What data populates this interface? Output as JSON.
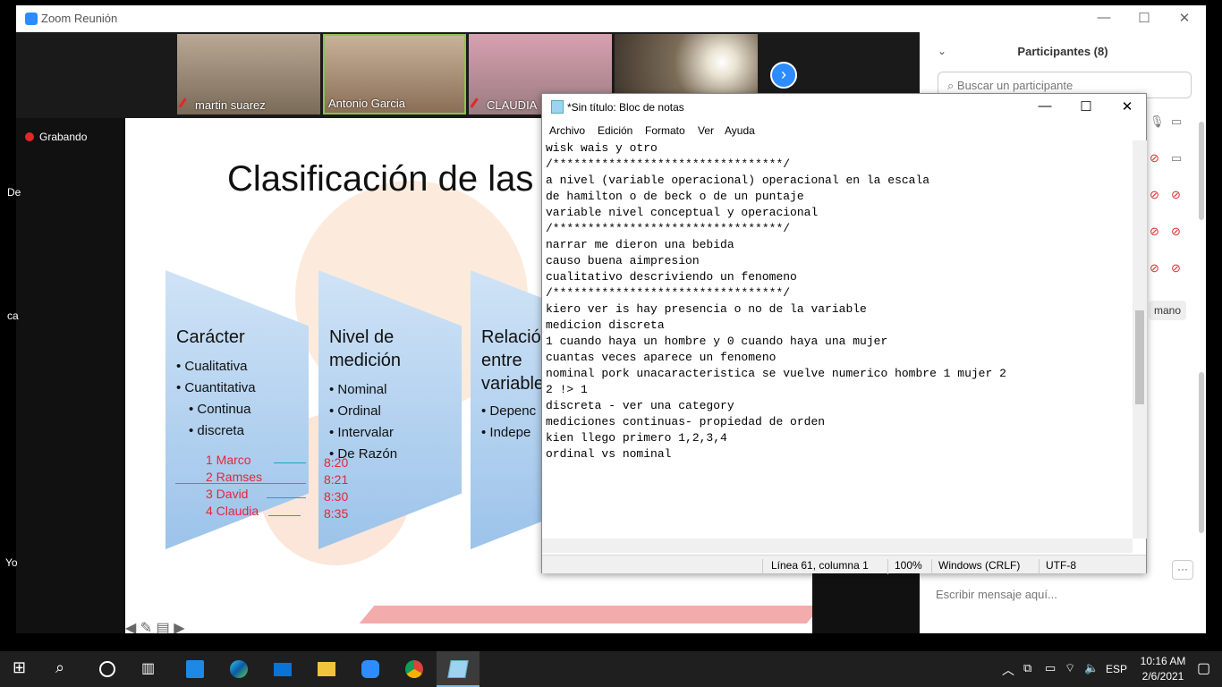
{
  "zoom": {
    "window_title": "Zoom Reunión",
    "participants": [
      {
        "name": "martin suarez",
        "muted": true
      },
      {
        "name": "Antonio Garcia",
        "muted": false
      },
      {
        "name": "CLAUDIA",
        "muted": true
      },
      {
        "name": "",
        "muted": false
      }
    ],
    "recording_label": "Grabando",
    "panel_title": "Participantes (8)",
    "search_placeholder": "Buscar un participante",
    "raise_hand": "mano",
    "chat_placeholder": "Escribir mensaje aquí...",
    "more": "···",
    "slide": {
      "title": "Clasificación de las",
      "chevrons": [
        {
          "heading": "Carácter",
          "items": [
            "• Cualitativa",
            "• Cuantitativa",
            "• Continua",
            "• discreta"
          ]
        },
        {
          "heading": "Nivel de\nmedición",
          "items": [
            "• Nominal",
            "• Ordinal",
            "• Intervalar",
            "• De Razón"
          ]
        },
        {
          "heading": "Relació\nentre\nvariable",
          "items": [
            "• Depenc",
            "• Indepe"
          ]
        }
      ],
      "red_names": [
        "1 Marco",
        "2 Ramses",
        "3 David",
        "4 Claudia"
      ],
      "red_times": [
        "8:20",
        "8:21",
        "8:30",
        "8:35"
      ]
    }
  },
  "desktop_side_text": [
    "De",
    "ca",
    "Yo"
  ],
  "notepad": {
    "title": "*Sin título: Bloc de notas",
    "menu": [
      "Archivo",
      "Edición",
      "Formato",
      "Ver",
      "Ayuda"
    ],
    "content": "wisk wais y otro\n/*********************************/\na nivel (variable operacional) operacional en la escala\nde hamilton o de beck o de un puntaje\nvariable nivel conceptual y operacional\n/*********************************/\nnarrar me dieron una bebida\ncauso buena aimpresion\ncualitativo descriviendo un fenomeno\n/*********************************/\nkiero ver is hay presencia o no de la variable\nmedicion discreta\n1 cuando haya un hombre y 0 cuando haya una mujer\ncuantas veces aparece un fenomeno\nnominal pork unacaracteristica se vuelve numerico hombre 1 mujer 2\n2 !> 1\ndiscreta - ver una category\nmediciones continuas- propiedad de orden\nkien llego primero 1,2,3,4\nordinal vs nominal\n",
    "status": {
      "position": "Línea 61, columna 1",
      "zoom": "100%",
      "line_ending": "Windows (CRLF)",
      "encoding": "UTF-8"
    }
  },
  "taskbar": {
    "language": "ESP",
    "time": "10:16 AM",
    "date": "2/6/2021"
  },
  "colors": {
    "zoom_blue": "#2d8cff",
    "muted_red": "#e02828",
    "slide_red_text": "#e0283a"
  }
}
